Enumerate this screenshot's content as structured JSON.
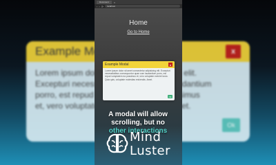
{
  "background_modal": {
    "title": "Example Mod",
    "close": "x",
    "body_lines": [
      "Lorem ipsum dolo                       ipiscing elit.",
      "Excepturi necessit                      cum laudantium",
      "porro, est repud                          ea possimus",
      "et, vero voluptate                        uia! Amet."
    ],
    "ok": "Ok"
  },
  "browser": {
    "tab_label": "Document",
    "tab_close": "×",
    "nav_back": "‹",
    "nav_forward": "›",
    "nav_reload": "⟳",
    "url": "localhost"
  },
  "page": {
    "title": "Home",
    "link": "Go to Home"
  },
  "modal": {
    "title": "Example Modal",
    "close": "x",
    "body": "Lorem ipsum dolor sit amet consectetur adipisicing elit. Excepturi necessitatibus consequuntur quae cum laudantium porro, est repud voluptatem ea possimus et, vero voluptate eveniet iusto. Quia quis, voluptate molestias reiciendis. Amet.",
    "ok": "Ok"
  },
  "caption": {
    "line1": "A modal will allow",
    "line2": "scrolling, but no",
    "line3": "other interactions"
  },
  "brand": {
    "line1": "Mind",
    "line2": "Luster"
  }
}
